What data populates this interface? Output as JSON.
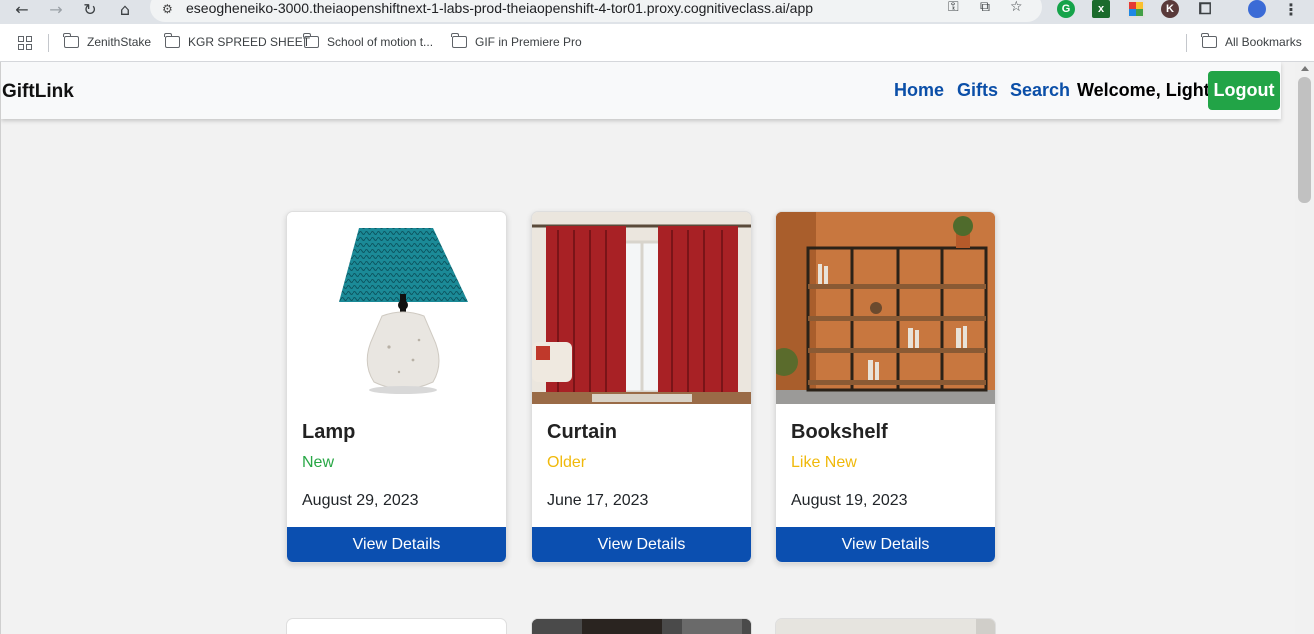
{
  "browser": {
    "url": "eseogheneiko-3000.theiaopenshiftnext-1-labs-prod-theiaopenshift-4-tor01.proxy.cognitiveclass.ai/app",
    "icons": [
      "back-icon",
      "forward-icon",
      "reload-icon",
      "home-icon",
      "site-settings-icon",
      "password-key-icon",
      "install-app-icon",
      "bookmark-star-icon",
      "extensions-icon",
      "menu-icon"
    ],
    "bookmarks": [
      "ZenithStake",
      "KGR SPREED SHEET",
      "School of motion t...",
      "GIF in Premiere Pro"
    ],
    "all_bookmarks": "All Bookmarks",
    "extension_letters": [
      "K"
    ]
  },
  "navbar": {
    "brand": "GiftLink",
    "links": [
      "Home",
      "Gifts",
      "Search"
    ],
    "welcome": "Welcome, Light",
    "logout": "Logout"
  },
  "gifts": [
    {
      "name": "Lamp",
      "condition": "New",
      "condition_color": "#28a745",
      "date": "August 29, 2023",
      "button": "View Details"
    },
    {
      "name": "Curtain",
      "condition": "Older",
      "condition_color": "#f0b90b",
      "date": "June 17, 2023",
      "button": "View Details"
    },
    {
      "name": "Bookshelf",
      "condition": "Like New",
      "condition_color": "#f0b90b",
      "date": "August 19, 2023",
      "button": "View Details"
    }
  ],
  "colors": {
    "link": "#0b4fa8",
    "logout": "#22a447",
    "button": "#0b4fb0"
  }
}
